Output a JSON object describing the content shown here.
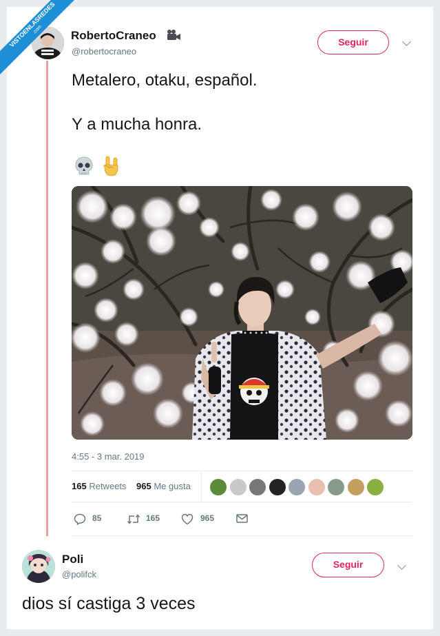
{
  "watermark": {
    "line1": "VISTOENLASREDES",
    "line2": ".com"
  },
  "tweet": {
    "author_name": "RobertoCraneo",
    "author_emoji_icon": "movie-camera-icon",
    "author_handle": "@robertocraneo",
    "follow_label": "Seguir",
    "text_line1": "Metalero, otaku, español.",
    "text_line2": "Y a mucha honra.",
    "emojis": [
      "skull-emoji",
      "sign-of-the-horns-emoji"
    ],
    "timestamp": "4:55 - 3 mar. 2019",
    "retweets_count": "165",
    "retweets_label": "Retweets",
    "likes_count": "965",
    "likes_label": "Me gusta",
    "liker_avatar_colors": [
      "#5a8a3a",
      "#c9c9c9",
      "#777777",
      "#222222",
      "#9aa5b1",
      "#e8c0b0",
      "#8a9a8a",
      "#c4a060",
      "#8ab040"
    ],
    "actions": {
      "reply_count": "85",
      "retweet_count": "165",
      "like_count": "965"
    }
  },
  "reply": {
    "author_name": "Poli",
    "author_handle": "@polifck",
    "follow_label": "Seguir",
    "text": "dios sí castiga 3 veces"
  },
  "colors": {
    "accent": "#e0245e",
    "thread_line": "#e9a0a4",
    "ribbon": "#1d8fd6",
    "secondary_text": "#657786"
  }
}
